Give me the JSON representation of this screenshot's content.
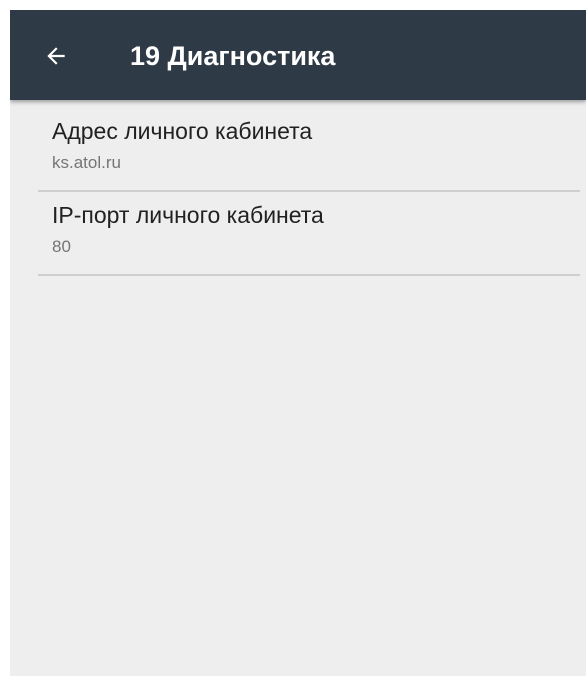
{
  "toolbar": {
    "back_icon": "arrow-back-icon",
    "title": "19 Диагностика",
    "background_color": "#2e3a46",
    "title_color": "#ffffff"
  },
  "preferences": [
    {
      "title": "Адрес личного кабинета",
      "summary": "ks.atol.ru"
    },
    {
      "title": "IP-порт личного кабинета",
      "summary": "80"
    }
  ],
  "colors": {
    "background": "#eeeeee",
    "primary_text": "#212121",
    "secondary_text": "#757575",
    "divider": "#cfcfcf"
  }
}
